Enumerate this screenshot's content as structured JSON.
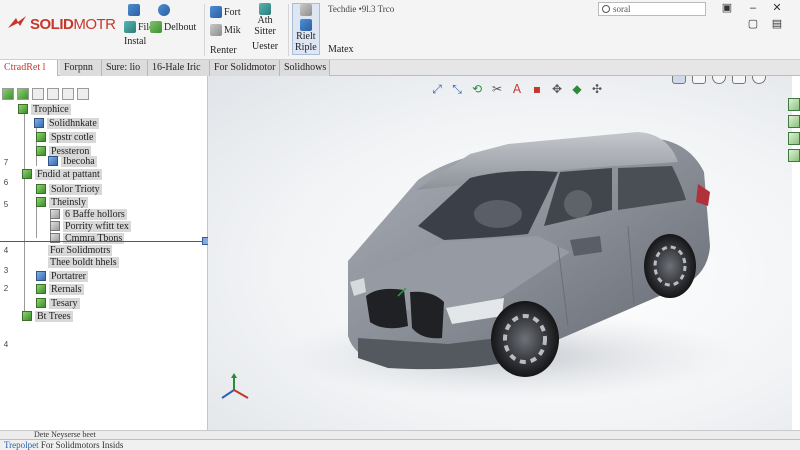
{
  "app": {
    "logo_text_bold": "SOLID",
    "logo_text_thin": "MOTR"
  },
  "ribbon": {
    "file_label": "File",
    "install_label": "Instal",
    "delbout_label": "Delbout",
    "fort_label": "Fort",
    "mik_label": "Mik",
    "renter_label": "Renter",
    "ath_label": "Ath",
    "sitter_label": "Sitter",
    "uester_label": "Uester",
    "rielt_label": "Rielt",
    "riple_label": "Riple",
    "matex_label": "Matex",
    "doc_title": "Techdie •9l.3 Trco",
    "search_placeholder": "soral"
  },
  "tabs": [
    {
      "label": "CtradRet l"
    },
    {
      "label": "Forpnn"
    },
    {
      "label": "Sure: lio"
    },
    {
      "label": "16-Hale Iric"
    },
    {
      "label": "For Solidmotor"
    },
    {
      "label": "Solidhows"
    }
  ],
  "left_numbers": [
    "7",
    "6",
    "5",
    "4",
    "3",
    "2",
    "4"
  ],
  "tree": [
    {
      "label": "Trophice",
      "icon": "green"
    },
    {
      "label": "Solidhnkate",
      "icon": "blue"
    },
    {
      "label": "Spstr cotle",
      "icon": "green"
    },
    {
      "label": "Pessteron",
      "icon": "green"
    },
    {
      "label": "Ibecoha",
      "icon": "blue"
    },
    {
      "label": "Fndid at pattant",
      "icon": "green"
    },
    {
      "label": "Solor Trioty",
      "icon": "green"
    },
    {
      "label": "Theinsly",
      "icon": "green"
    },
    {
      "label": "6 Baffe hollors",
      "icon": "gray"
    },
    {
      "label": "Porrity wfitt tex",
      "icon": "gray"
    },
    {
      "label": "Cmmra Tbons",
      "icon": "gray"
    },
    {
      "label": "For Solidmotrs",
      "icon": "none"
    },
    {
      "label": "Thee boldt hhels",
      "icon": "none"
    },
    {
      "label": "Portatrer",
      "icon": "blue"
    },
    {
      "label": "Rernals",
      "icon": "green"
    },
    {
      "label": "Tesary",
      "icon": "green"
    },
    {
      "label": "Bt Trees",
      "icon": "green"
    }
  ],
  "status": {
    "left_prefix": "Trepolpet",
    "left_text": "For Solidmotors Insids",
    "mid_text": "Dete Neyserse beet"
  },
  "colors": {
    "accent_red": "#c8362b",
    "tree_green": "#3a8c2c",
    "selection_blue": "#2f5ea8"
  }
}
